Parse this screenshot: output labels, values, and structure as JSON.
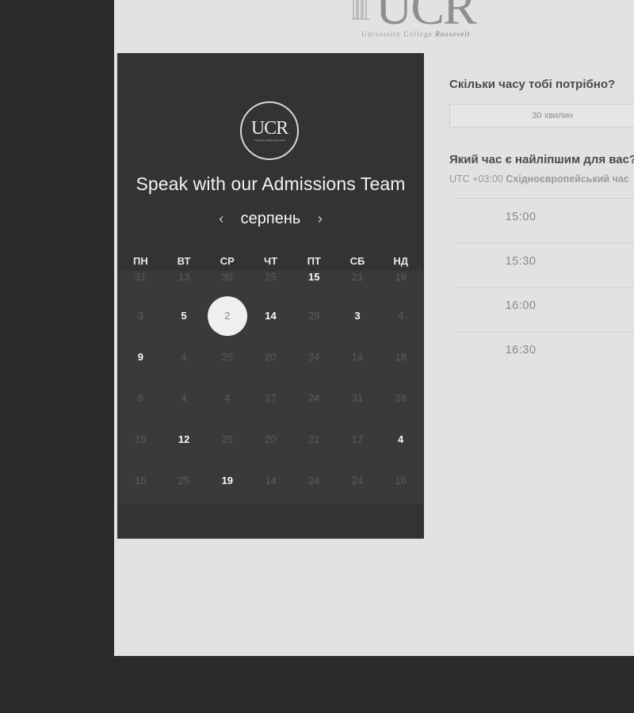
{
  "header": {
    "logo_text": "UCR",
    "logo_tagline_prefix": "University College",
    "logo_tagline_suffix": "Roosevelt"
  },
  "panel": {
    "logo_text": "UCR",
    "logo_sub": "University College Roosevelt",
    "title": "Speak with our Admissions Team",
    "month": "серпень",
    "prev_symbol": "‹",
    "next_symbol": "›",
    "weekdays": [
      "ПН",
      "ВТ",
      "СР",
      "ЧТ",
      "ПТ",
      "СБ",
      "НД"
    ],
    "weeks": [
      [
        "31",
        "13",
        "30",
        "25",
        "15",
        "21",
        "19"
      ],
      [
        "3",
        "5",
        "2",
        "14",
        "29",
        "3",
        "4"
      ],
      [
        "9",
        "4",
        "25",
        "20",
        "24",
        "14",
        "18"
      ],
      [
        "6",
        "4",
        "4",
        "27",
        "24",
        "31",
        "28"
      ],
      [
        "19",
        "12",
        "25",
        "20",
        "21",
        "17",
        "4"
      ],
      [
        "15",
        "25",
        "19",
        "14",
        "24",
        "24",
        "16"
      ]
    ],
    "available_cells": [
      "0-4",
      "1-1",
      "1-3",
      "1-5",
      "2-0",
      "4-1",
      "4-6",
      "5-2"
    ],
    "selected_cell": "1-2"
  },
  "booking": {
    "duration_question": "Скільки часу тобі потрібно?",
    "duration_value": "30 хвилин",
    "time_question": "Який час є найліпшим для вас?",
    "timezone_offset": "UTC +03:00",
    "timezone_name": "Східноєвропейський час",
    "slots": [
      "15:00",
      "15:30",
      "16:00",
      "16:30"
    ]
  },
  "colors": {
    "outer_background": "#2b2b2b",
    "page_background": "#e2e2e2",
    "panel_background": "#333333",
    "selected_day": "#efefef"
  }
}
